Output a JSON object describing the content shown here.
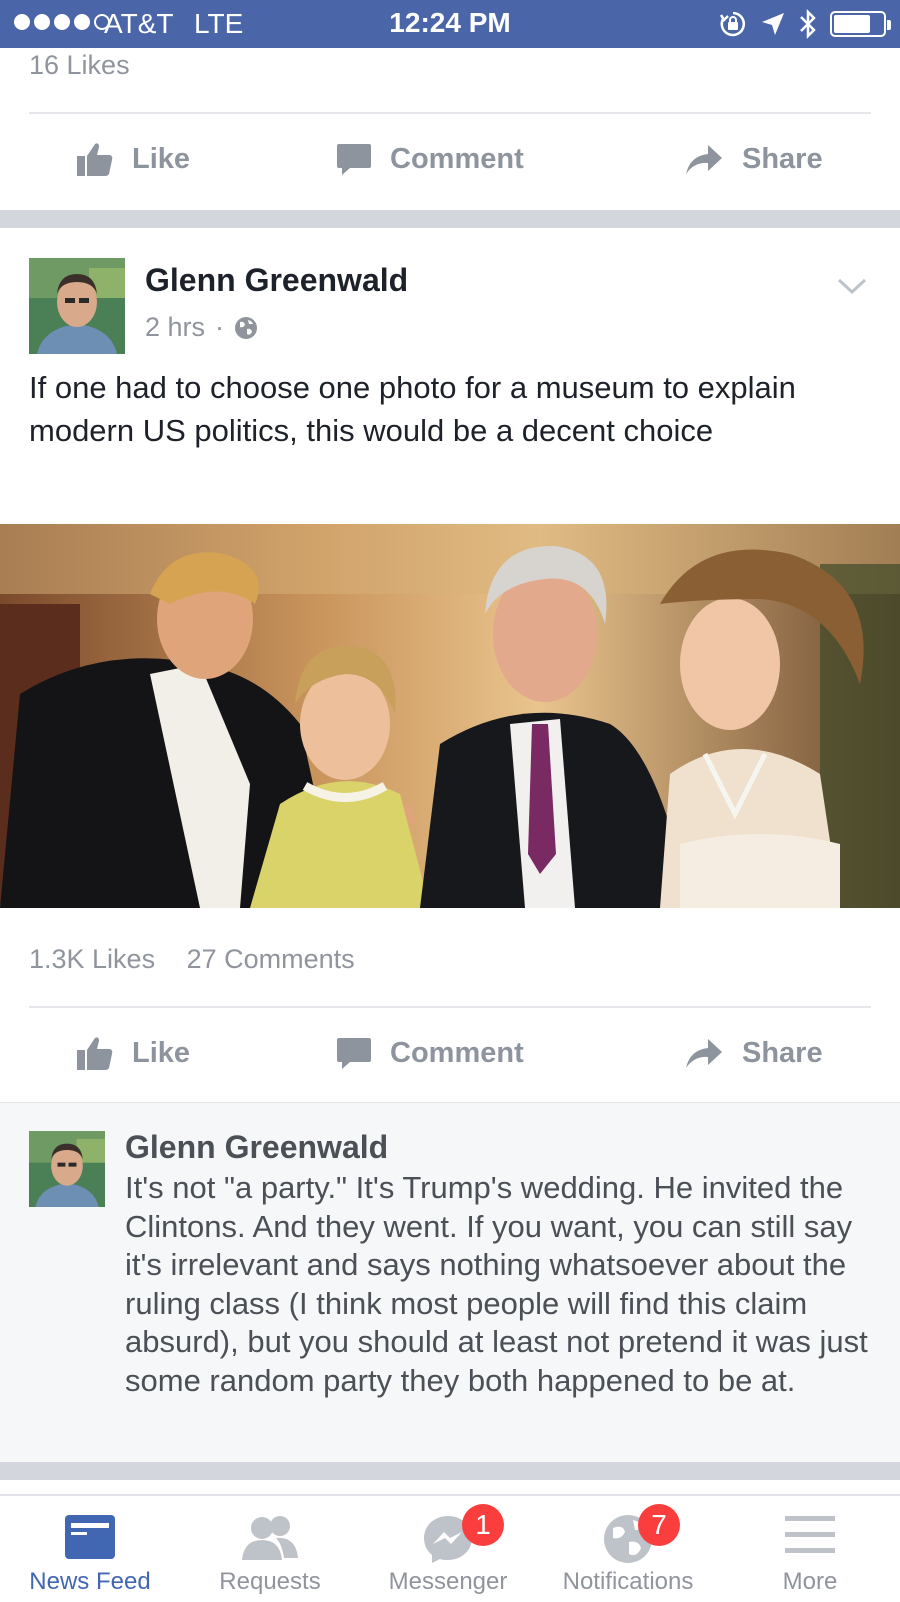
{
  "status_bar": {
    "carrier": "AT&T",
    "network": "LTE",
    "time": "12:24 PM",
    "signal_bars": 4,
    "signal_max": 5,
    "icons": [
      "rotation-lock-icon",
      "location-icon",
      "bluetooth-icon",
      "battery-icon"
    ],
    "battery_level": 0.75
  },
  "previous_post": {
    "likes": "16 Likes",
    "actions": {
      "like": "Like",
      "comment": "Comment",
      "share": "Share"
    }
  },
  "post": {
    "author": "Glenn Greenwald",
    "time": "2 hrs",
    "separator": "·",
    "audience_icon": "globe-icon",
    "text": "If one had to choose one photo for a museum to explain modern US politics, this would be a decent choice",
    "likes": "1.3K Likes",
    "comments": "27 Comments",
    "actions": {
      "like": "Like",
      "comment": "Comment",
      "share": "Share"
    }
  },
  "comment": {
    "author": "Glenn Greenwald",
    "text": "It's not \"a party.\" It's Trump's wedding. He invited the Clintons. And they went. If you want, you can still say it's irrelevant and says nothing whatsoever about the ruling class (I think most people will find this claim absurd), but you should at least not pretend it was just some random party they both happened to be at."
  },
  "tab_bar": {
    "tabs": [
      {
        "label": "News Feed",
        "icon": "news-feed-icon",
        "active": true
      },
      {
        "label": "Requests",
        "icon": "friend-requests-icon",
        "active": false
      },
      {
        "label": "Messenger",
        "icon": "messenger-icon",
        "badge": "1",
        "active": false
      },
      {
        "label": "Notifications",
        "icon": "globe-icon",
        "badge": "7",
        "active": false
      },
      {
        "label": "More",
        "icon": "menu-icon",
        "active": false
      }
    ]
  },
  "colors": {
    "brand": "#4267b2",
    "status_bar": "#4b66a8",
    "badge": "#fa3e3e",
    "secondary_text": "#90949c"
  }
}
